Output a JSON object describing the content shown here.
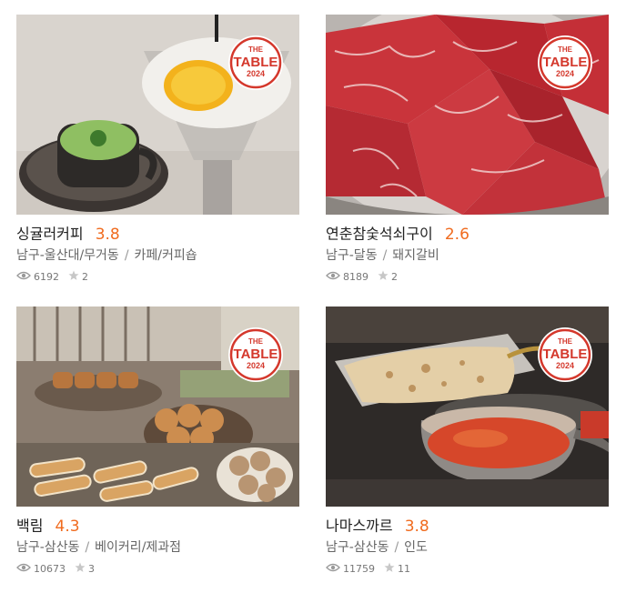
{
  "badge": {
    "line1": "THE",
    "line2": "TABLE",
    "line3": "2024"
  },
  "colors": {
    "score": "#f06b1e",
    "badge": "#d4382c"
  },
  "cards": [
    {
      "name": "싱귤러커피",
      "score": "3.8",
      "region": "남구-울산대/무거동",
      "category": "카페/커피숍",
      "views": "6192",
      "stars": "2"
    },
    {
      "name": "연춘참숯석쇠구이",
      "score": "2.6",
      "region": "남구-달동",
      "category": "돼지갈비",
      "views": "8189",
      "stars": "2"
    },
    {
      "name": "백림",
      "score": "4.3",
      "region": "남구-삼산동",
      "category": "베이커리/제과점",
      "views": "10673",
      "stars": "3"
    },
    {
      "name": "나마스까르",
      "score": "3.8",
      "region": "남구-삼산동",
      "category": "인도",
      "views": "11759",
      "stars": "11"
    }
  ]
}
